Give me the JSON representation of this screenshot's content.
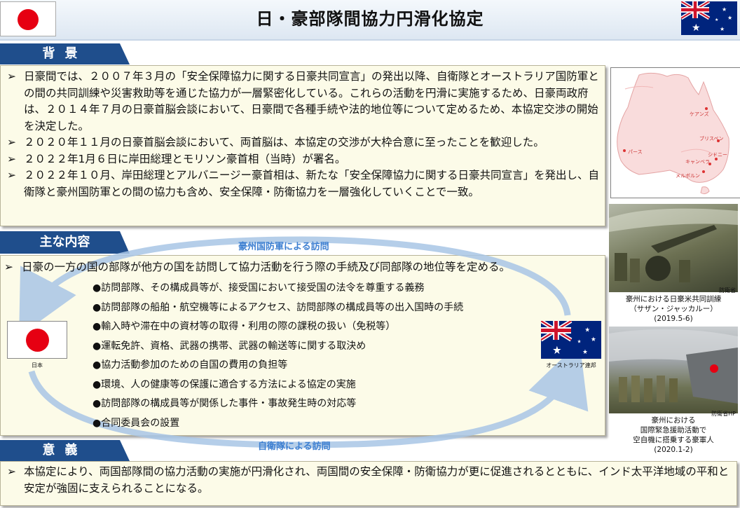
{
  "header": {
    "title": "日・豪部隊間協力円滑化協定"
  },
  "colors": {
    "section_label_bg": "#1f4e8c",
    "box_bg": "#fcfbe8",
    "arrow_blue": "#a9c6e6",
    "arrow_label": "#3d7fd1",
    "flag_red": "#e60012",
    "flag_blue": "#00247d"
  },
  "sections": {
    "background_label": "背景",
    "main_label": "主な内容",
    "significance_label": "意義"
  },
  "background": {
    "bullet_marker": "➢",
    "bullets": [
      "日豪間では、２００７年３月の「安全保障協力に関する日豪共同宣言」の発出以降、自衛隊とオーストラリア国防軍との間の共同訓練や災害救助等を通じた協力が一層緊密化している。これらの活動を円滑に実施するため、日豪両政府は、２０１４年７月の日豪首脳会談において、日豪間で各種手続や法的地位等について定めるため、本協定交渉の開始を決定した。",
      "２０２０年１１月の日豪首脳会談において、両首脳は、本協定の交渉が大枠合意に至ったことを歓迎した。",
      "２０２２年1月６日に岸田総理とモリソン豪首相（当時）が署名。",
      "２０２２年１０月、岸田総理とアルバニージー豪首相は、新たな「安全保障協力に関する日豪共同宣言」を発出し、自衛隊と豪州国防軍との間の協力も含め、安全保障・防衛協力を一層強化していくことで一致。"
    ]
  },
  "main_content": {
    "arrow_top_label": "豪州国防軍による訪問",
    "arrow_bottom_label": "自衛隊による訪問",
    "lead": "日豪の一方の国の部隊が他方の国を訪問して協力活動を行う際の手続及び同部隊の地位等を定める。",
    "item_marker": "●",
    "items": [
      "訪問部隊、その構成員等が、接受国において接受国の法令を尊重する義務",
      "訪問部隊の船舶・航空機等によるアクセス、訪問部隊の構成員等の出入国時の手続",
      "輸入時や滞在中の資材等の取得・利用の際の課税の扱い（免税等）",
      "運転免許、資格、武器の携帯、武器の輸送等に関する取決め",
      "協力活動参加のための自国の費用の負担等",
      "環境、人の健康等の保護に適合する方法による協定の実施",
      "訪問部隊の構成員等が関係した事件・事故発生時の対応等",
      "合同委員会の設置"
    ],
    "flag_japan_caption": "日本",
    "flag_australia_caption": "オーストラリア連邦"
  },
  "significance": {
    "bullet_marker": "➢",
    "text": "本協定により、両国部隊間の協力活動の実施が円滑化され、両国間の安全保障・防衛協力が更に促進されるとともに、インド太平洋地域の平和と安定が強固に支えられることになる。"
  },
  "map": {
    "labels": [
      "ケアンズ",
      "ブリスベン",
      "パース",
      "シドニー",
      "キャンベラ",
      "メルボルン"
    ]
  },
  "photos": {
    "photo1_credit": "防衛省",
    "photo1_caption_lines": [
      "豪州における日豪米共同訓練",
      "（サザン・ジャッカルー）",
      "(2019.5-6)"
    ],
    "photo2_credit": "防衛省HP",
    "photo2_caption_lines": [
      "豪州における",
      "国際緊急援助活動で",
      "空自機に搭乗する豪軍人",
      "(2020.1-2)"
    ]
  }
}
